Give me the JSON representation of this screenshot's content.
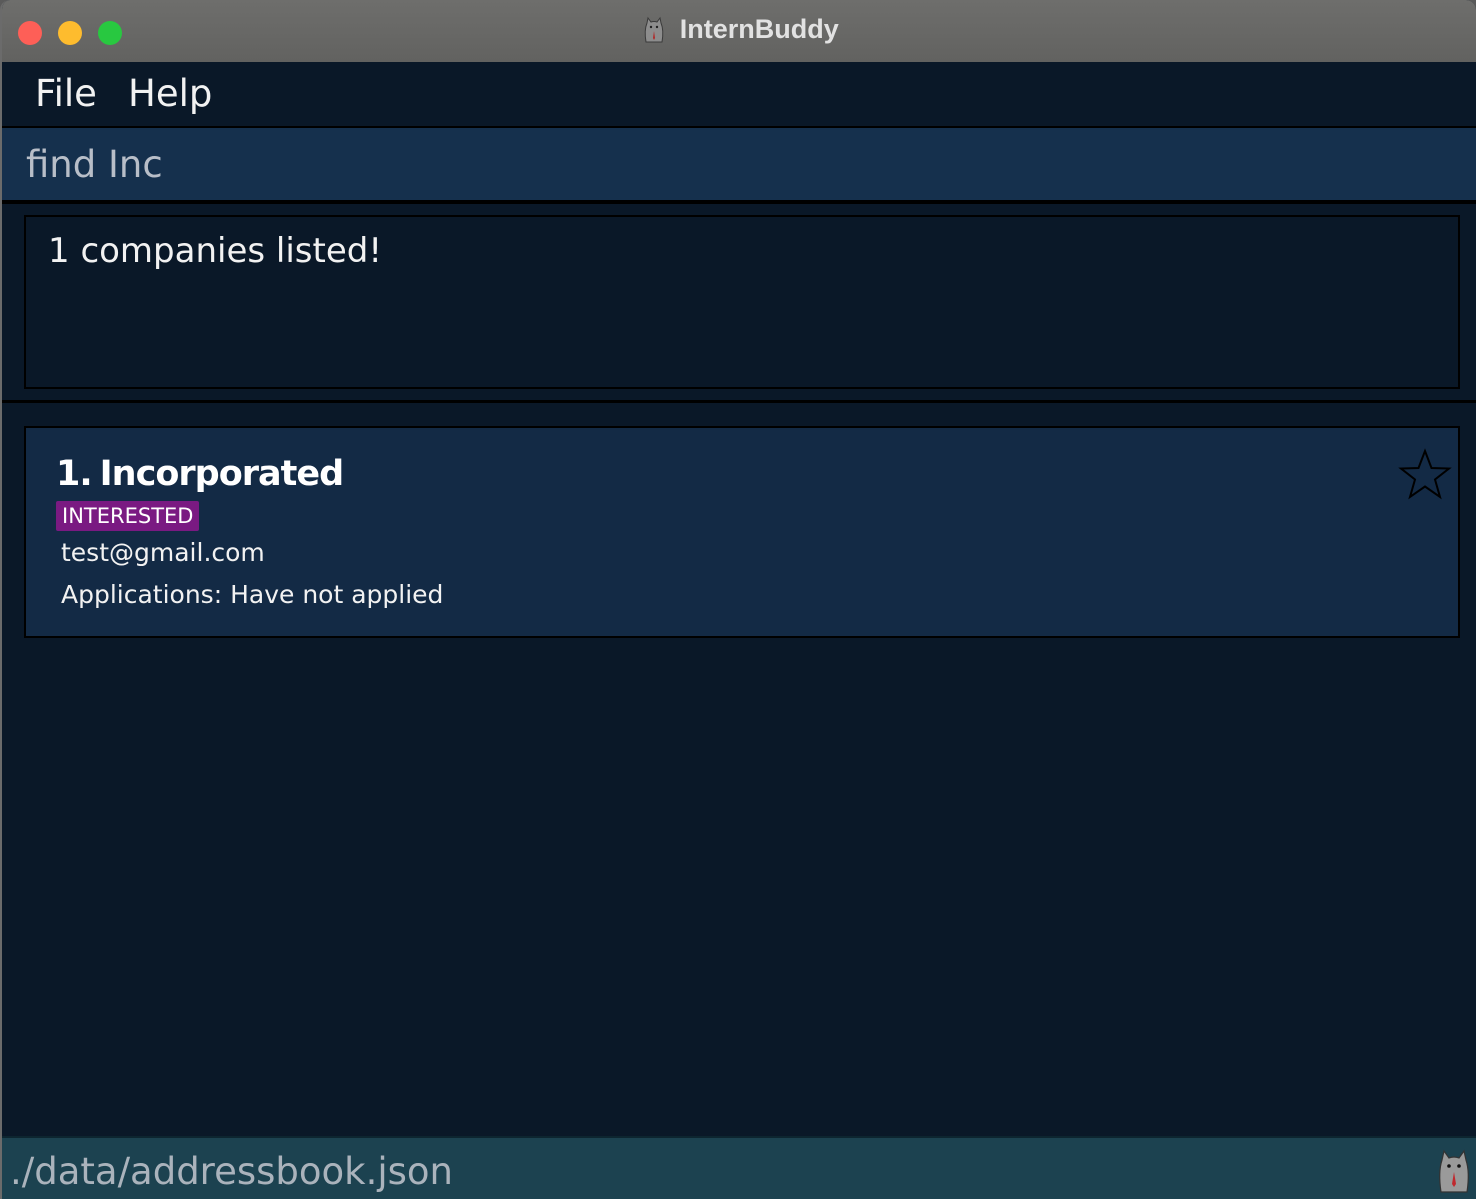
{
  "window": {
    "title": "InternBuddy"
  },
  "menu": {
    "file_label": "File",
    "help_label": "Help"
  },
  "command": {
    "value": "find Inc"
  },
  "result": {
    "message": "1 companies listed!"
  },
  "companies": [
    {
      "index": "1.",
      "name": "Incorporated",
      "status": "INTERESTED",
      "email": "test@gmail.com",
      "applications": "Applications: Have not applied",
      "favourite": false
    }
  ],
  "status_bar": {
    "path": "./data/addressbook.json"
  },
  "colors": {
    "background": "#0a1828",
    "card": "#132a45",
    "command_box": "#15304d",
    "status_bar": "#1c4250",
    "badge_interested": "#7a1a82"
  },
  "icons": {
    "app_icon": "cat-mascot-icon",
    "favourite": "star-outline-icon"
  }
}
